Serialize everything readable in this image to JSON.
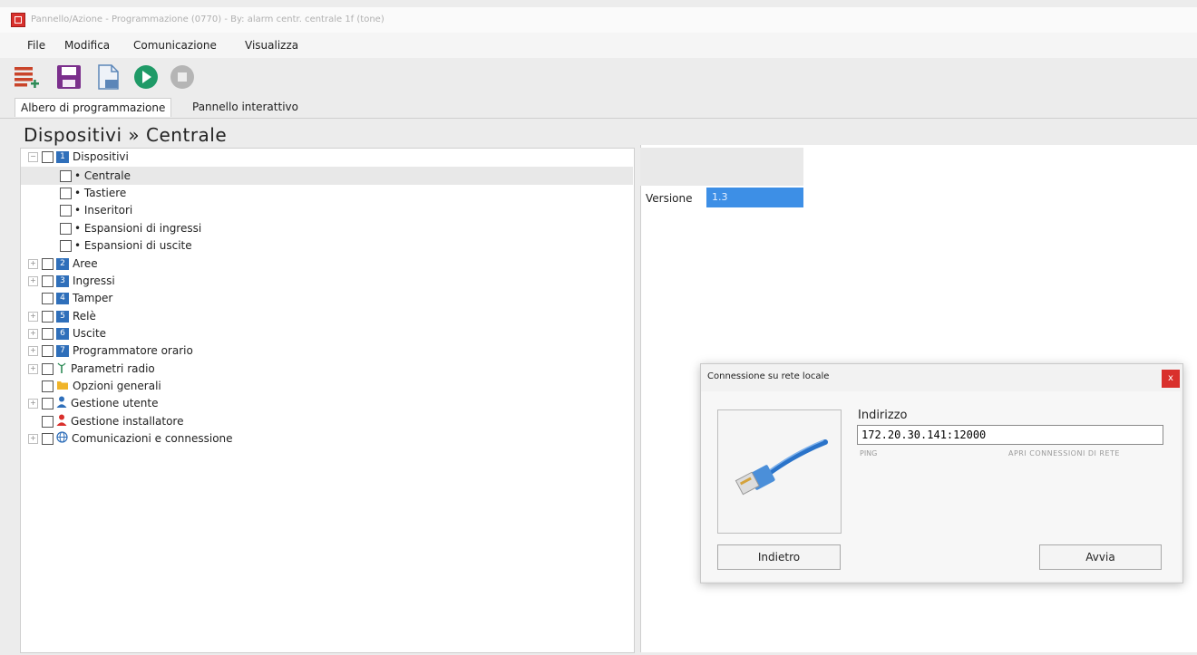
{
  "window": {
    "title": "Pannello/Azione - Programmazione (0770) - By: alarm centr. centrale 1f (tone)"
  },
  "menu": [
    "File",
    "Modifica",
    "Comunicazione",
    "Visualizza"
  ],
  "toolbar": {
    "icons": [
      "list-add-icon",
      "save-icon",
      "export-document-icon",
      "play-icon",
      "stop-icon"
    ],
    "colors": {
      "list": "#c9442a",
      "save": "#7b2f8c",
      "document": "#5c86b8",
      "play": "#1f9a67",
      "stop": "#b5b5b5"
    }
  },
  "tabs": [
    {
      "label": "Albero di programmazione"
    },
    {
      "label": "Pannello interattivo"
    }
  ],
  "breadcrumb": "Dispositivi » Centrale",
  "tree": {
    "root": {
      "num": "1",
      "label": "Dispositivi"
    },
    "children": [
      "• Centrale",
      "• Tastiere",
      "• Inseritori",
      "• Espansioni di ingressi",
      "• Espansioni di uscite"
    ],
    "items": [
      {
        "num": "2",
        "label": "Aree"
      },
      {
        "num": "3",
        "label": "Ingressi"
      },
      {
        "num": "4",
        "label": "Tamper"
      },
      {
        "num": "5",
        "label": "Relè"
      },
      {
        "num": "6",
        "label": "Uscite"
      },
      {
        "num": "7",
        "label": "Programmatore orario"
      },
      {
        "label": "Parametri radio"
      },
      {
        "label": "Opzioni generali"
      },
      {
        "label": "Gestione utente"
      },
      {
        "label": "Gestione installatore"
      },
      {
        "label": "Comunicazioni e connessione"
      }
    ]
  },
  "details": {
    "label": "Versione",
    "value": "1.3"
  },
  "dialog": {
    "title": "Connessione su rete locale",
    "close": "x",
    "address_label": "Indirizzo",
    "address_value": "172.20.30.141:12000",
    "ping": "PING",
    "open_network": "APRI CONNESSIONI DI RETE",
    "back": "Indietro",
    "start": "Avvia"
  }
}
